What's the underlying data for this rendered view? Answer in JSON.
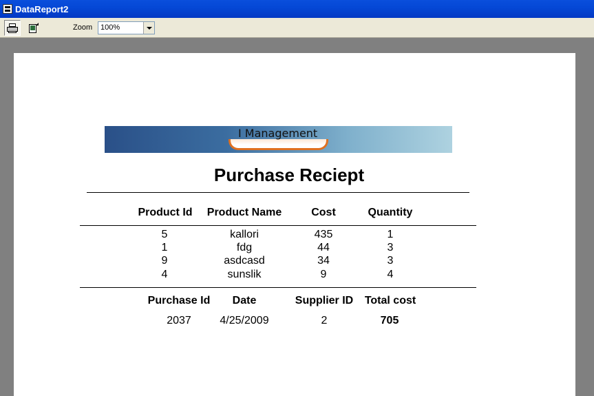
{
  "window": {
    "title": "DataReport2"
  },
  "toolbar": {
    "zoom_label": "Zoom",
    "zoom_value": "100%",
    "print_icon": "printer-icon",
    "export_icon": "export-icon"
  },
  "report": {
    "banner_text": "I Management",
    "title": "Purchase Reciept",
    "columns": [
      "Product Id",
      "Product Name",
      "Cost",
      "Quantity"
    ],
    "rows": [
      [
        "5",
        "kallori",
        "435",
        "1"
      ],
      [
        "1",
        "fdg",
        "44",
        "3"
      ],
      [
        "9",
        "asdcasd",
        "34",
        "3"
      ],
      [
        "4",
        "sunslik",
        "9",
        "4"
      ]
    ],
    "summary_columns": [
      "Purchase Id",
      "Date",
      "Supplier ID",
      "Total cost"
    ],
    "summary_values": [
      "2037",
      "4/25/2009",
      "2",
      "705"
    ]
  }
}
